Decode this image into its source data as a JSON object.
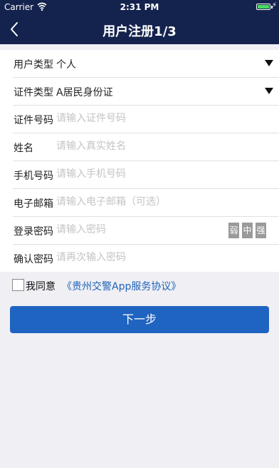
{
  "status_bar": {
    "carrier": "Carrier",
    "time": "2:31 PM",
    "charge_symbol": "⚡",
    "wifi_icon": "wifi-icon"
  },
  "nav": {
    "title": "用户注册1/3",
    "back_icon": "chevron-left-icon"
  },
  "form": {
    "user_type": {
      "label": "用户类型",
      "value": "个人"
    },
    "id_type": {
      "label": "证件类型",
      "value": "A居民身份证"
    },
    "id_number": {
      "label": "证件号码",
      "placeholder": "请输入证件号码"
    },
    "name": {
      "label": "姓名",
      "placeholder": "请输入真实姓名"
    },
    "phone": {
      "label": "手机号码",
      "placeholder": "请输入手机号码"
    },
    "email": {
      "label": "电子邮箱",
      "placeholder": "请输入电子邮箱（可选）"
    },
    "password": {
      "label": "登录密码",
      "placeholder": "请输入密码",
      "strength": [
        "弱",
        "中",
        "强"
      ]
    },
    "confirm_password": {
      "label": "确认密码",
      "placeholder": "请再次输入密码"
    }
  },
  "agreement": {
    "text": "我同意",
    "link": "《贵州交警App服务协议》",
    "checked": false
  },
  "next_button": {
    "label": "下一步"
  },
  "colors": {
    "navbar": "#14234d",
    "primary": "#1f64c0",
    "link": "#1f63b8",
    "background": "#efeff4",
    "strength_badge": "#9a9a9a"
  }
}
